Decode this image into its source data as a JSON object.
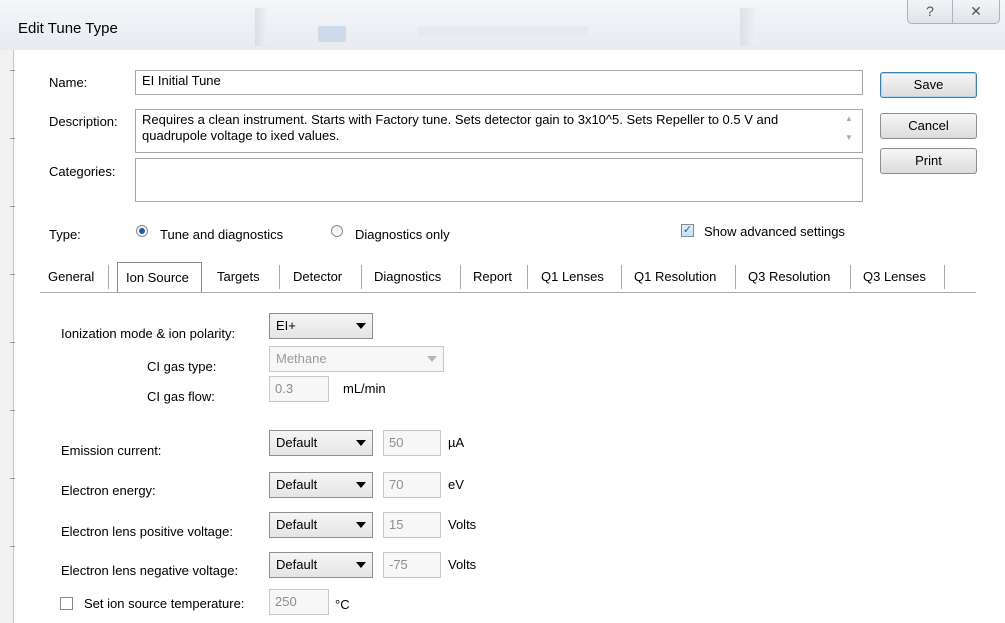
{
  "window": {
    "title": "Edit Tune Type",
    "help_symbol": "?",
    "close_symbol": "✕"
  },
  "form": {
    "name_label": "Name:",
    "name_value": "EI Initial Tune",
    "description_label": "Description:",
    "description_value": "Requires a clean instrument. Starts with Factory tune. Sets detector gain to 3x10^5. Sets Repeller to 0.5 V and quadrupole voltage to ixed values.",
    "categories_label": "Categories:",
    "categories_value": "",
    "type_label": "Type:",
    "type_options": [
      {
        "label": "Tune and diagnostics",
        "selected": true
      },
      {
        "label": "Diagnostics only",
        "selected": false
      }
    ],
    "show_advanced_label": "Show advanced settings",
    "show_advanced_checked": true
  },
  "buttons": {
    "save": "Save",
    "cancel": "Cancel",
    "print": "Print"
  },
  "tabs": [
    "General",
    "Ion Source",
    "Targets",
    "Detector",
    "Diagnostics",
    "Report",
    "Q1 Lenses",
    "Q1 Resolution",
    "Q3 Resolution",
    "Q3 Lenses"
  ],
  "active_tab": "Ion Source",
  "ion_source": {
    "ionization_label": "Ionization mode & ion polarity:",
    "ionization_value": "EI+",
    "ci_gas_type_label": "CI gas type:",
    "ci_gas_type_value": "Methane",
    "ci_gas_flow_label": "CI gas flow:",
    "ci_gas_flow_value": "0.3",
    "ci_gas_flow_unit": "mL/min",
    "rows": [
      {
        "label": "Emission current:",
        "mode": "Default",
        "value": "50",
        "unit": "µA"
      },
      {
        "label": "Electron energy:",
        "mode": "Default",
        "value": "70",
        "unit": "eV"
      },
      {
        "label": "Electron lens positive voltage:",
        "mode": "Default",
        "value": "15",
        "unit": "Volts"
      },
      {
        "label": "Electron lens negative voltage:",
        "mode": "Default",
        "value": "-75",
        "unit": "Volts"
      }
    ],
    "temp_label": "Set ion source temperature:",
    "temp_checked": false,
    "temp_value": "250",
    "temp_unit": "°C"
  }
}
